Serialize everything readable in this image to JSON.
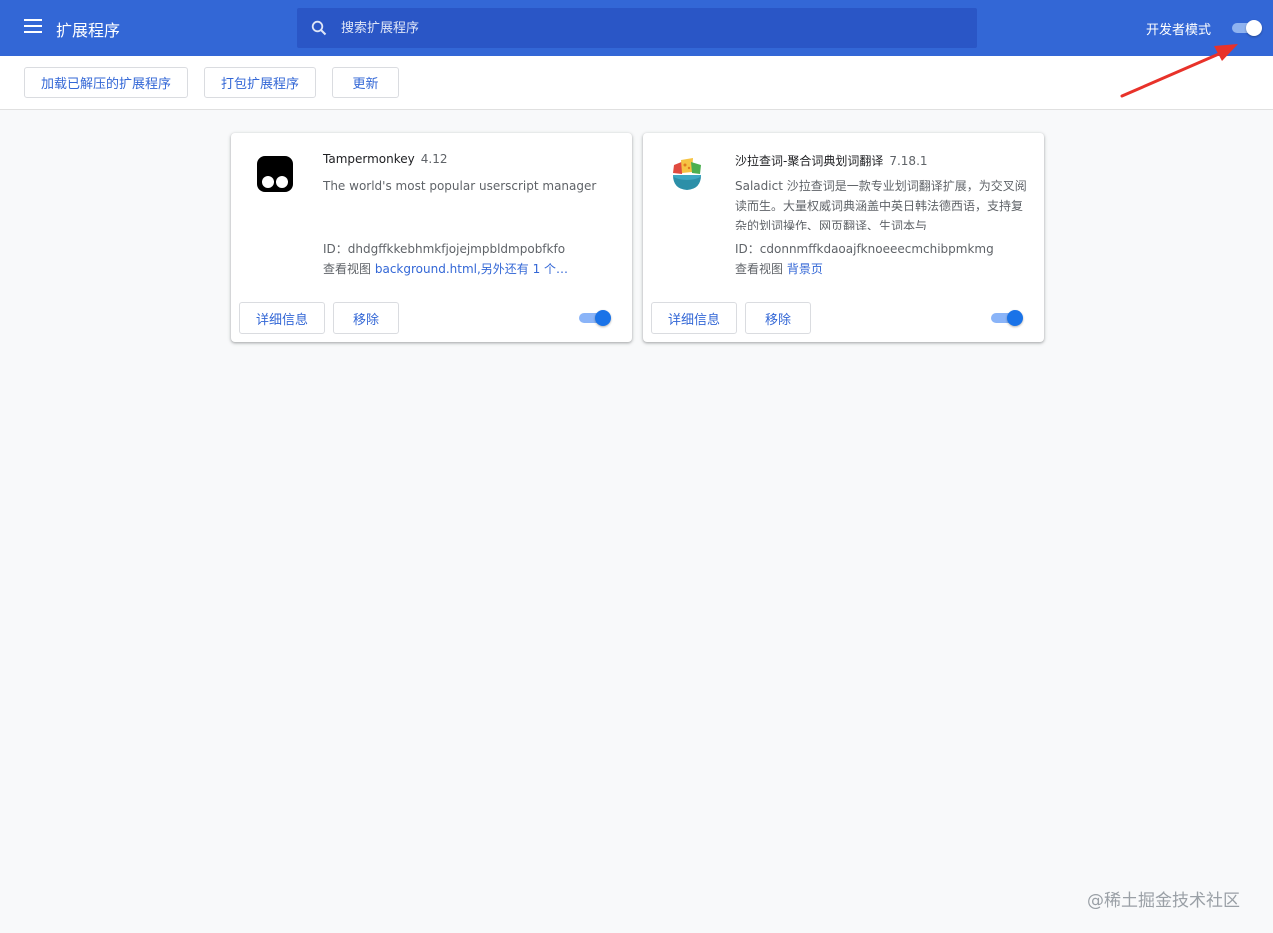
{
  "header": {
    "title": "扩展程序",
    "search_placeholder": "搜索扩展程序",
    "dev_mode_label": "开发者模式",
    "dev_mode_on": true,
    "accent_color": "#3367d6"
  },
  "toolbar": {
    "load_unpacked": "加载已解压的扩展程序",
    "pack": "打包扩展程序",
    "update": "更新"
  },
  "extensions": [
    {
      "name": "Tampermonkey",
      "version": "4.12",
      "description": "The world's most popular userscript manager",
      "id_line": "ID：dhdgffkkebhmkfjojejmpbldmpobfkfo",
      "views_label": "查看视图",
      "views_link": "background.html,另外还有 1 个…",
      "details_label": "详细信息",
      "remove_label": "移除",
      "enabled": true,
      "icon": "tampermonkey-icon"
    },
    {
      "name": "沙拉查词-聚合词典划词翻译",
      "version": "7.18.1",
      "description": "Saladict 沙拉查词是一款专业划词翻译扩展，为交叉阅读而生。大量权威词典涵盖中英日韩法德西语，支持复杂的划词操作、网页翻译、生词本与",
      "id_line": "ID：cdonnmffkdaoajfknoeeecmchibpmkmg",
      "views_label": "查看视图",
      "views_link": "背景页",
      "details_label": "详细信息",
      "remove_label": "移除",
      "enabled": true,
      "icon": "saladict-icon"
    }
  ],
  "watermark": "@稀土掘金技术社区"
}
